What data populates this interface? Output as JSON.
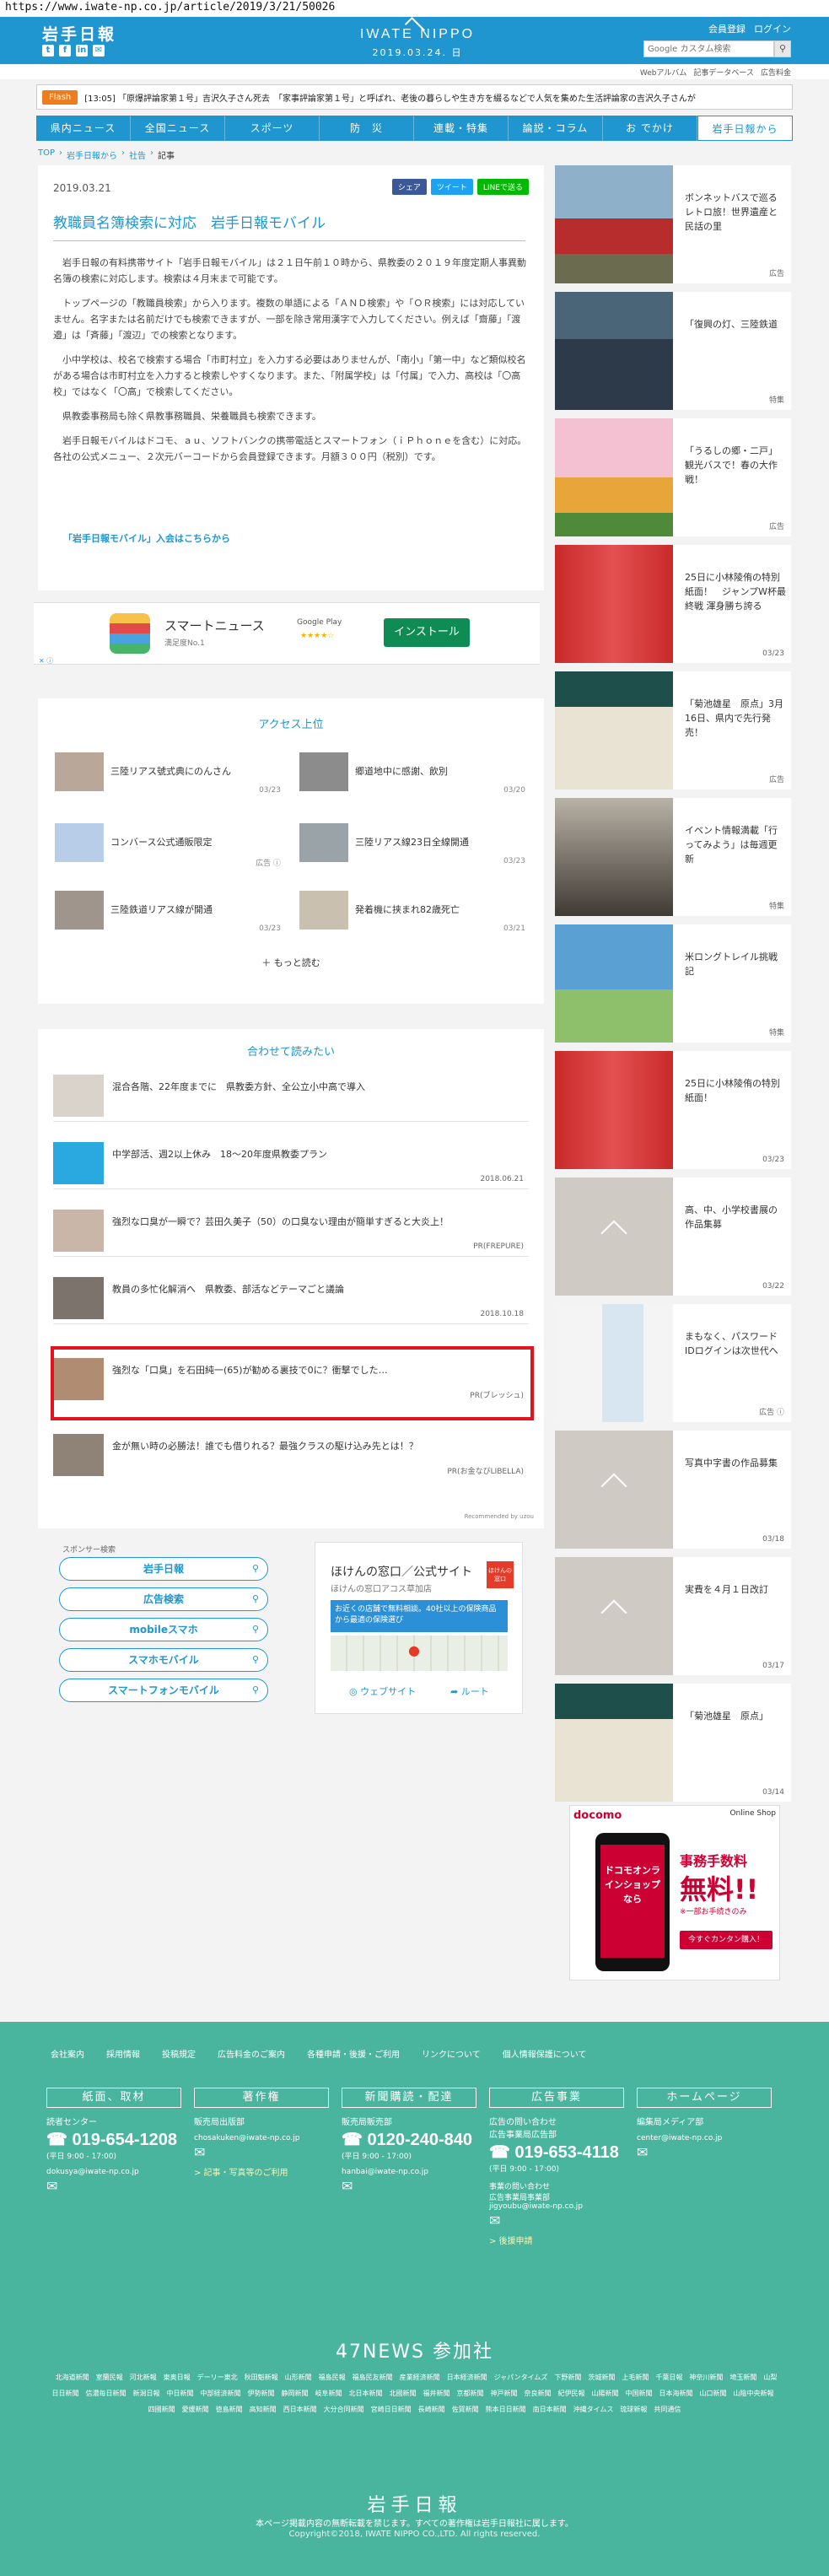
{
  "browser": {
    "url": "https://www.iwate-np.co.jp/article/2019/3/21/50026"
  },
  "header": {
    "logo": "岩手日報",
    "brand": "IWATE NIPPO",
    "date": "2019.03.24. 日",
    "member_link": "会員登録",
    "login_link": "ログイン",
    "search_placeholder": "Google カスタム検索",
    "social": [
      "t",
      "f",
      "in",
      "✉"
    ]
  },
  "subnav": [
    "Webアルバム",
    "記事データベース",
    "広告料金"
  ],
  "flash": {
    "badge": "Flash",
    "text": "[13:05] 「原爆評論家第１号」吉沢久子さん死去　「家事評論家第１号」と呼ばれ、老後の暮らしや生き方を綴るなどで人気を集めた生活評論家の吉沢久子さんが"
  },
  "nav": [
    {
      "label": "県内ニュース"
    },
    {
      "label": "全国ニュース"
    },
    {
      "label": "スポーツ"
    },
    {
      "label": "防　災"
    },
    {
      "label": "連載・特集"
    },
    {
      "label": "論説・コラム"
    },
    {
      "label": "お  でかけ"
    },
    {
      "label": "岩手日報から"
    }
  ],
  "breadcrumb": [
    "TOP",
    "岩手日報から",
    "社告",
    "記事"
  ],
  "article": {
    "date": "2019.03.21",
    "share": {
      "facebook": "シェア",
      "twitter": "ツイート",
      "line": "LINEで送る"
    },
    "title": "教職員名簿検索に対応　岩手日報モバイル",
    "paragraphs": [
      "岩手日報の有料携帯サイト「岩手日報モバイル」は２１日午前１０時から、県教委の２０１９年度定期人事異動名簿の検索に対応します。検索は４月末まで可能です。",
      "トップページの「教職員検索」から入ります。複数の単語による「ＡＮＤ検索」や「ＯＲ検索」には対応していません。名字または名前だけでも検索できますが、一部を除き常用漢字で入力してください。例えば「齋藤」「渡邉」は「斉藤」「渡辺」での検索となります。",
      "小中学校は、校名で検索する場合「市町村立」を入力する必要はありませんが、「南小」「第一中」など類似校名がある場合は市町村立を入力すると検索しやすくなります。また、「附属学校」は「付属」で入力、高校は「〇高校」ではなく「〇高」で検索してください。",
      "県教委事務局も除く県教事務職員、栄養職員も検索できます。",
      "岩手日報モバイルはドコモ、ａｕ、ソフトバンクの携帯電話とスマートフォン（ｉＰｈｏｎｅを含む）に対応。各社の公式メニュー、２次元バーコードから会員登録できます。月額３００円（税別）です。"
    ],
    "join_link": "「岩手日報モバイル」入会はこちらから"
  },
  "app_ad": {
    "name": "スマートニュース",
    "sub": "満足度No.1",
    "store": "Google Play",
    "stars": "★★★★☆",
    "install": "インストール",
    "adchoice": "✕ ⓘ"
  },
  "ranking": {
    "title": "アクセス上位",
    "items": [
      {
        "title": "三陸リアス號式典にのんさん",
        "date": "03/23"
      },
      {
        "title": "郷道地中に感謝、飲別",
        "date": "03/20"
      },
      {
        "title": "コンバース公式通販限定",
        "date": "広告 ⓘ"
      },
      {
        "title": "三陸リアス線23日全線開通",
        "date": "03/23"
      },
      {
        "title": "三陸鉄道リアス線が開通",
        "date": "03/23"
      },
      {
        "title": "発着機に挟まれ82歳死亡",
        "date": "03/21"
      }
    ],
    "more": "＋ もっと読む"
  },
  "related": {
    "title": "合わせて読みたい",
    "items": [
      {
        "title": "混合各階、22年度までに　県教委方針、全公立小中高で導入",
        "meta": ""
      },
      {
        "title": "中学部活、週2以上休み　18〜20年度県教委プラン",
        "meta": "2018.06.21"
      },
      {
        "title": "強烈な口臭が一瞬で？芸田久美子（50）の口臭ない理由が簡単すぎると大炎上！",
        "meta": "PR(FREPURE)"
      },
      {
        "title": "教員の多忙化解消へ　県教委、部活などテーマごと議論",
        "meta": "2018.10.18"
      },
      {
        "title": "強烈な「口臭」を石田純一(65)が勧める裏技で0に？衝撃でした…",
        "meta": "PR(ブレッシュ)"
      },
      {
        "title": "金が無い時の必勝法！誰でも借りれる？最強クラスの駆け込み先とは！？",
        "meta": "PR(お金なびLIBELLA)"
      }
    ],
    "recommended": "Recommended by  uzou"
  },
  "sponsor": {
    "label": "スポンサー検索",
    "buttons": [
      "岩手日報",
      "広告検索",
      "mobileスマホ",
      "スマホモバイル",
      "スマートフォンモバイル"
    ]
  },
  "map_ad": {
    "title": "ほけんの窓口／公式サイト",
    "sub": "ほけんの窓口アコス草加店",
    "logo": "ほけんの窓口",
    "banner": "お近くの店舗で無料相談。40社以上の保険商品から最適の保険選び",
    "site": "ウェブサイト",
    "route": "ルート"
  },
  "sidebar": [
    {
      "title": "ボンネットバスで巡るレトロ旅！世界遺産と民話の里",
      "meta": "広告"
    },
    {
      "title": "「復興の灯、三陸鉄道",
      "meta": "特集"
    },
    {
      "title": "「うるしの郷・二戸」観光バスで！春の大作戦！",
      "meta": "広告"
    },
    {
      "title": "25日に小林陵侑の特別紙面！　ジャンプW杯最終戦 渾身勝ち誇る",
      "meta": "03/23"
    },
    {
      "title": "「菊池雄星　原点」3月16日、県内で先行発売！",
      "meta": "広告"
    },
    {
      "title": "イベント情報満載「行ってみよう」は毎週更新",
      "meta": "特集"
    },
    {
      "title": "米ロングトレイル挑戦記",
      "meta": "特集"
    },
    {
      "title": "25日に小林陵侑の特別紙面！",
      "meta": "03/23"
    },
    {
      "title": "高、中、小学校書展の作品集募",
      "meta": "03/22"
    },
    {
      "title": "まもなく、パスワードIDログインは次世代へ",
      "meta": "広告 ⓘ"
    },
    {
      "title": "写真中字書の作品募集",
      "meta": "03/18"
    },
    {
      "title": "実費を４月１日改訂",
      "meta": "03/17"
    },
    {
      "title": "「菊池雄星　原点」",
      "meta": "03/14"
    }
  ],
  "docomo_ad": {
    "logo": "docomo",
    "online": "Online Shop",
    "screen": "ドコモオンラインショップなら",
    "fee1": "事務手数料",
    "fee2": "無料!!",
    "fee3": "※一部お手続きのみ",
    "button": "今すぐカンタン購入！"
  },
  "footer": {
    "links": [
      "会社案内",
      "採用情報",
      "投稿規定",
      "広告料金のご案内",
      "各種申請・後援・ご利用",
      "リンクについて",
      "個人情報保護について"
    ],
    "columns": [
      {
        "head": "紙面、取材",
        "sub": "読者センター",
        "tel": "019-654-1208",
        "hours": "(平日 9:00 - 17:00)",
        "mail": "dokusya@iwate-np.co.jp",
        "note": ""
      },
      {
        "head": "著作権",
        "sub": "販売局出版部",
        "tel": "",
        "hours": "",
        "mail": "chosakuken@iwate-np.co.jp",
        "note": "> 記事・写真等のご利用"
      },
      {
        "head": "新聞購読・配達",
        "sub": "販売局販売部",
        "tel": "0120-240-840",
        "hours": "(平日 9:00 - 17:00)",
        "mail": "hanbai@iwate-np.co.jp",
        "note": ""
      },
      {
        "head": "広告事業",
        "sub": "広告の問い合わせ\n広告事業局広告部",
        "tel": "019-653-4118",
        "hours": "(平日 9:00 - 17:00)",
        "mail": "事業の問い合わせ\n広告事業局事業部\njigyoubu@iwate-np.co.jp",
        "note": "> 後援申請"
      },
      {
        "head": "ホームページ",
        "sub": "編集局メディア部",
        "tel": "",
        "hours": "",
        "mail": "center@iwate-np.co.jp",
        "note": ""
      }
    ],
    "news47": "47NEWS 参加社",
    "papers": [
      "北海道新聞",
      "室蘭民報",
      "河北新報",
      "東奥日報",
      "デーリー東北",
      "秋田魁新報",
      "山形新聞",
      "福島民報",
      "福島民友新聞",
      "産業経済新聞",
      "日本経済新聞",
      "ジャパンタイムズ",
      "下野新聞",
      "茨城新聞",
      "上毛新聞",
      "千葉日報",
      "神奈川新聞",
      "埼玉新聞",
      "山梨日日新聞",
      "信濃毎日新聞",
      "新潟日報",
      "中日新聞",
      "中部経済新聞",
      "伊勢新聞",
      "静岡新聞",
      "岐阜新聞",
      "北日本新聞",
      "北國新聞",
      "福井新聞",
      "京都新聞",
      "神戸新聞",
      "奈良新聞",
      "紀伊民報",
      "山陽新聞",
      "中国新聞",
      "日本海新聞",
      "山口新聞",
      "山陰中央新報",
      "四國新聞",
      "愛媛新聞",
      "徳島新聞",
      "高知新聞",
      "西日本新聞",
      "大分合同新聞",
      "宮崎日日新聞",
      "長崎新聞",
      "佐賀新聞",
      "熊本日日新聞",
      "南日本新聞",
      "沖縄タイムス",
      "琉球新報",
      "共同通信"
    ],
    "logo": "岩手日報",
    "note": "本ページ掲載内容の無断転載を禁じます。すべての著作権は岩手日報社に属します。",
    "copyright": "Copyright©2018, IWATE NIPPO CO.,LTD. All rights reserved."
  },
  "colors": {
    "brand": "#1f96cf",
    "footer": "#4ab59e",
    "flash": "#ee7d1e",
    "highlight": "#e1131c"
  }
}
